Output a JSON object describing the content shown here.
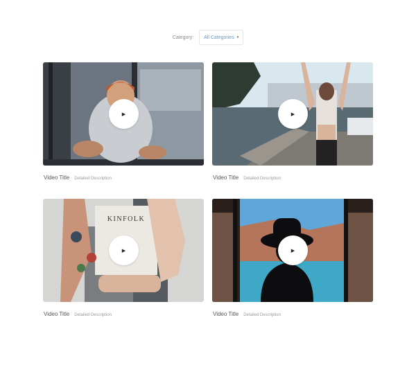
{
  "filter": {
    "label": "Category:",
    "selected": "All Categories",
    "caret": "▾"
  },
  "videos": [
    {
      "title": "Video Title",
      "description": "Detailed Description",
      "play_icon": "▶"
    },
    {
      "title": "Video Title",
      "description": "Detailed Description",
      "play_icon": "▶"
    },
    {
      "title": "Video Title",
      "description": "Detailed Description",
      "play_icon": "▶"
    },
    {
      "title": "Video Title",
      "description": "Detailed Description",
      "play_icon": "▶"
    }
  ],
  "thumbnails": {
    "video_3_book_title": "KINFOLK"
  },
  "colors": {
    "accent": "#5b9bd5"
  }
}
